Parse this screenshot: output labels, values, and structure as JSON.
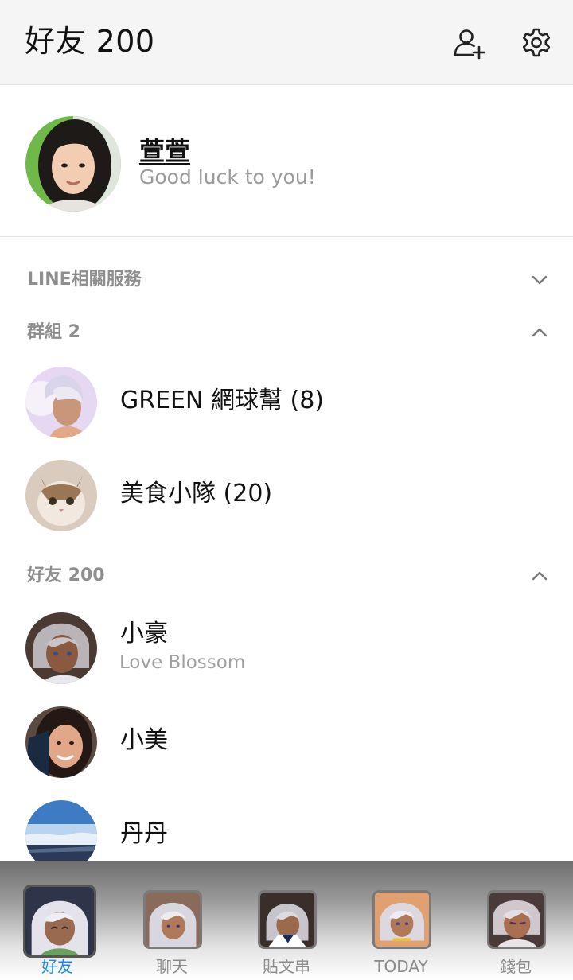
{
  "header": {
    "title": "好友 200",
    "icons": [
      "add-friend-icon",
      "settings-icon"
    ]
  },
  "profile": {
    "name": "萱萱",
    "status": "Good luck to you!"
  },
  "sections": {
    "line_services": {
      "label": "LINE相關服務",
      "expanded": false
    },
    "groups": {
      "label": "群組 2",
      "expanded": true
    },
    "friends": {
      "label": "好友 200",
      "expanded": true
    }
  },
  "groups": [
    {
      "name": "GREEN 網球幫 (8)"
    },
    {
      "name": "美食小隊 (20)"
    }
  ],
  "friends": [
    {
      "name": "小豪",
      "status": "Love Blossom"
    },
    {
      "name": "小美",
      "status": ""
    },
    {
      "name": "丹丹",
      "status": ""
    }
  ],
  "tabs": [
    {
      "label": "好友",
      "active": true
    },
    {
      "label": "聊天",
      "active": false
    },
    {
      "label": "貼文串",
      "active": false
    },
    {
      "label": "TODAY",
      "active": false
    },
    {
      "label": "錢包",
      "active": false
    }
  ],
  "colors": {
    "accent": "#1f8be0",
    "header_bg": "#f5f5f5",
    "section_label": "#8e8e8e",
    "status_text": "#9a9a9a"
  }
}
